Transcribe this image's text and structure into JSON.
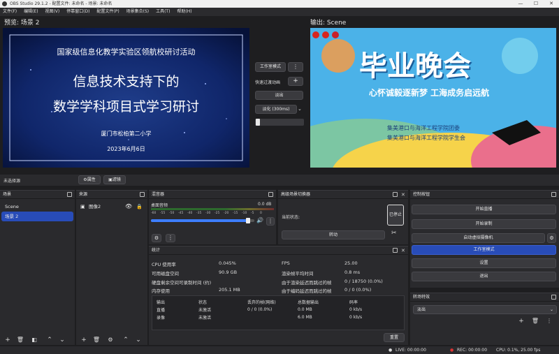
{
  "window": {
    "title": "OBS Studio 29.1.2 - 配置文件: 未命名 - 场景: 未命名",
    "min": "—",
    "max": "☐",
    "close": "✕"
  },
  "menu": [
    "文件(F)",
    "编辑(E)",
    "视图(V)",
    "停靠窗口(D)",
    "配置文件(P)",
    "场景集合(S)",
    "工具(T)",
    "帮助(H)"
  ],
  "preview": {
    "label": "预览: 场景 2",
    "header": "国家级信息化教学实验区领航校研讨活动",
    "title1": "信息技术支持下的",
    "title2": "数学学科项目式学习研讨",
    "school": "厦门市松柏第二小学",
    "date": "2023年6月6日"
  },
  "program": {
    "label": "输出: Scene",
    "title": "毕业晚会",
    "subtitle": "心怀诚毅逐新梦  工海成务启远航",
    "line1": "集美港口与海洋工程学院团委",
    "line2": "集美港口与海洋工程学院学生会"
  },
  "transition_mid": {
    "studio_btn": "工作室模式",
    "quick_label": "快速过渡动画",
    "fade": "淡出",
    "cut": "截切",
    "duration": "淡化 (300ms)"
  },
  "source_bar": {
    "none": "未选择源",
    "props": "属性",
    "filters": "滤镜"
  },
  "scenes": {
    "title": "场景",
    "items": [
      "Scene",
      "场景 2"
    ]
  },
  "sources": {
    "title": "来源",
    "items": [
      "图像2"
    ]
  },
  "mixer": {
    "title": "混音器",
    "channel": "桌面音频",
    "db": "0.0 dB",
    "ticks": [
      "-60",
      "-55",
      "-50",
      "-45",
      "-40",
      "-35",
      "-30",
      "-25",
      "-20",
      "-15",
      "-10",
      "-5",
      "0"
    ],
    "volume_pct": 0.94
  },
  "advanced": {
    "title": "高级场景切换器",
    "status_label": "当前状态:",
    "status_btn": "已停止",
    "transition_btn": "转动"
  },
  "stats": {
    "title": "统计",
    "left": [
      {
        "label": "CPU 使用率",
        "value": "0.045%"
      },
      {
        "label": "可用磁盘空间",
        "value": "90.9 GB"
      },
      {
        "label": "硬盘剩余空间可录制时间 (约)",
        "value": ""
      },
      {
        "label": "内存使用",
        "value": "205.1 MB"
      }
    ],
    "right": [
      {
        "label": "FPS",
        "value": "25.00"
      },
      {
        "label": "渲染帧平均时间",
        "value": "0.8 ms"
      },
      {
        "label": "由于渲染延迟而跳过的帧",
        "value": "0 / 18750 (0.0%)"
      },
      {
        "label": "由于编码延迟而跳过的帧",
        "value": "0 / 0 (0.0%)"
      }
    ],
    "table_headers": [
      "输出",
      "状态",
      "丢弃的帧(网络)",
      "总数据输出",
      "码率"
    ],
    "table_rows": [
      [
        "直播",
        "未激活",
        "0 / 0 (0.0%)",
        "0.0 MB",
        "0 kb/s"
      ],
      [
        "录像",
        "未激活",
        "",
        "6.0 MB",
        "0 kb/s"
      ]
    ],
    "reset": "重置"
  },
  "controls": {
    "title": "控制按钮",
    "start_stream": "开始直播",
    "start_record": "开始录制",
    "virtual_cam": "启动虚拟摄像机",
    "studio_mode": "工作室模式",
    "settings": "设置",
    "exit": "退出"
  },
  "transitions": {
    "title": "转场特效",
    "selected": "淡出"
  },
  "statusbar": {
    "live": "LIVE: 00:00:00",
    "rec": "REC: 00:00:00",
    "cpu": "CPU: 0.1%, 25.00 fps"
  },
  "colors": {
    "accent": "#284cb8",
    "panel": "#2a2a2d",
    "bg": "#1e1e20"
  }
}
